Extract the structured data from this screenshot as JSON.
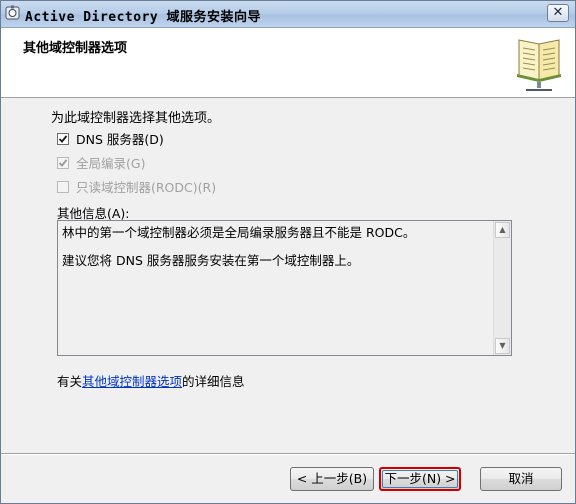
{
  "window": {
    "title": "Active Directory 域服务安装向导",
    "close_glyph": "✕"
  },
  "header": {
    "title": "其他域控制器选项"
  },
  "body": {
    "prompt": "为此域控制器选择其他选项。",
    "options": [
      {
        "label": "DNS 服务器(D)",
        "checked": true,
        "enabled": true
      },
      {
        "label": "全局编录(G)",
        "checked": true,
        "enabled": false
      },
      {
        "label": "只读域控制器(RODC)(R)",
        "checked": false,
        "enabled": false
      }
    ],
    "info_label": "其他信息(A):",
    "info_lines": [
      "林中的第一个域控制器必须是全局编录服务器且不能是 RODC。",
      "建议您将 DNS 服务器服务安装在第一个域控制器上。"
    ],
    "help_prefix": "有关",
    "help_link": "其他域控制器选项",
    "help_suffix": "的详细信息"
  },
  "buttons": {
    "back": "< 上一步(B)",
    "next": "下一步(N) >",
    "cancel": "取消"
  },
  "icons": {
    "app": "ad-wizard-icon",
    "header": "book-icon",
    "scroll_up": "scroll-up-arrow-icon",
    "scroll_down": "scroll-down-arrow-icon"
  },
  "colors": {
    "next_button_highlight": "#cc0000",
    "link": "#0033cc"
  }
}
